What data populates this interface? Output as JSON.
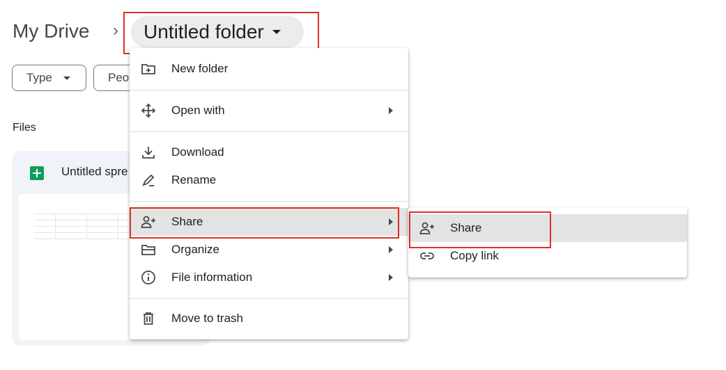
{
  "breadcrumb": {
    "root": "My Drive",
    "separator": "›",
    "current": "Untitled folder"
  },
  "filters": [
    {
      "label": "Type"
    },
    {
      "label": "Peo"
    }
  ],
  "section": {
    "label": "Files"
  },
  "file_card": {
    "name": "Untitled spre"
  },
  "context_menu": {
    "items": [
      {
        "label": "New folder",
        "icon": "new-folder-icon"
      },
      {
        "label": "Open with",
        "icon": "open-with-icon",
        "submenu": true
      },
      {
        "label": "Download",
        "icon": "download-icon"
      },
      {
        "label": "Rename",
        "icon": "rename-icon"
      },
      {
        "label": "Share",
        "icon": "share-icon",
        "submenu": true
      },
      {
        "label": "Organize",
        "icon": "organize-icon",
        "submenu": true
      },
      {
        "label": "File information",
        "icon": "info-icon",
        "submenu": true
      },
      {
        "label": "Move to trash",
        "icon": "trash-icon"
      }
    ]
  },
  "share_submenu": {
    "items": [
      {
        "label": "Share",
        "icon": "share-icon"
      },
      {
        "label": "Copy link",
        "icon": "link-icon"
      }
    ]
  },
  "colors": {
    "highlight": "#d93025",
    "sheets_green": "#0f9d58",
    "active_bg": "#e3e3e3"
  }
}
